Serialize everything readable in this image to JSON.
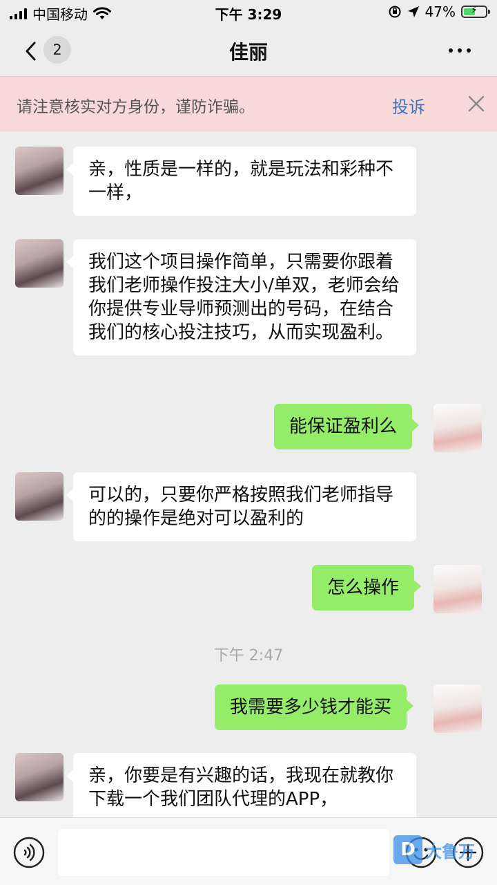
{
  "status_bar": {
    "carrier": "中国移动",
    "time": "下午 3:29",
    "battery_percent": "47%",
    "battery_level": 0.47
  },
  "nav": {
    "unread_count": "2",
    "title": "佳丽"
  },
  "warning": {
    "text": "请注意核实对方身份，谨防诈骗。",
    "report_label": "投诉"
  },
  "messages": [
    {
      "from": "them",
      "text": "亲，性质是一样的，就是玩法和彩种不一样，"
    },
    {
      "from": "them",
      "text": "我们这个项目操作简单，只需要你跟着我们老师操作投注大小/单双，老师会给你提供专业导师预测出的号码，在结合我们的核心投注技巧，从而实现盈利。"
    },
    {
      "from": "me",
      "text": "能保证盈利么"
    },
    {
      "from": "them",
      "text": "可以的，只要你严格按照我们老师指导的的操作是绝对可以盈利的"
    },
    {
      "from": "me",
      "text": "怎么操作"
    },
    {
      "from": "me",
      "text": "我需要多少钱才能买"
    },
    {
      "from": "them",
      "text": "亲，你要是有兴趣的话，我现在就教你下载一个我们团队代理的APP，"
    }
  ],
  "timestamp": "下午 2:47",
  "input": {
    "placeholder": ""
  },
  "watermark": {
    "text": "大鲁万"
  },
  "colors": {
    "background": "#ededed",
    "my_bubble": "#95ec69",
    "their_bubble": "#ffffff",
    "warning_bg": "#f7d9d9",
    "link": "#3d72c4"
  }
}
